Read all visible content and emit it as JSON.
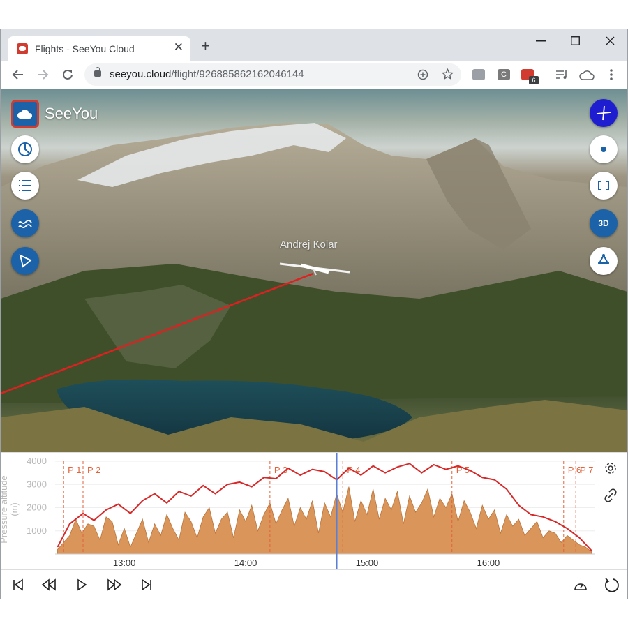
{
  "browser": {
    "tab_title": "Flights - SeeYou Cloud",
    "tab_close": "✕",
    "new_tab": "+",
    "url_host": "seeyou.cloud",
    "url_path": "/flight/926885862162046144",
    "ext_badge": "6",
    "ext_c": "C"
  },
  "app": {
    "brand": "SeeYou",
    "pilot_label": "Andrej Kolar",
    "btn_3d": "3D"
  },
  "chart_data": {
    "type": "area",
    "ylabel": "Pressure altitude (m)",
    "y_ticks": [
      "4000",
      "3000",
      "2000",
      "1000"
    ],
    "ylim": [
      0,
      4000
    ],
    "x_ticks": [
      "13:00",
      "14:00",
      "15:00",
      "16:00"
    ],
    "x_tick_hours": [
      13,
      14,
      15,
      16
    ],
    "xlim_hours": [
      12.43,
      16.88
    ],
    "cursor_hour": 14.75,
    "turnpoints": [
      {
        "label": "P 1",
        "hour": 12.5
      },
      {
        "label": "P 2",
        "hour": 12.66
      },
      {
        "label": "P 3",
        "hour": 14.2
      },
      {
        "label": "P 4",
        "hour": 14.8
      },
      {
        "label": "P 5",
        "hour": 15.7
      },
      {
        "label": "P 6",
        "hour": 16.62
      },
      {
        "label": "P 7",
        "hour": 16.72
      }
    ],
    "series": [
      {
        "color": "#d62a2a",
        "x": [
          12.45,
          12.55,
          12.66,
          12.75,
          12.85,
          12.95,
          13.05,
          13.15,
          13.25,
          13.35,
          13.45,
          13.55,
          13.65,
          13.75,
          13.85,
          13.95,
          14.05,
          14.15,
          14.25,
          14.35,
          14.45,
          14.55,
          14.65,
          14.75,
          14.85,
          14.95,
          15.05,
          15.15,
          15.25,
          15.35,
          15.45,
          15.55,
          15.65,
          15.75,
          15.85,
          15.95,
          16.05,
          16.15,
          16.25,
          16.35,
          16.45,
          16.55,
          16.65,
          16.75,
          16.85
        ],
        "values": [
          300,
          1300,
          1750,
          1450,
          1900,
          2150,
          1750,
          2300,
          2600,
          2200,
          2700,
          2500,
          2950,
          2600,
          3000,
          3100,
          2900,
          3300,
          3250,
          3700,
          3400,
          3650,
          3550,
          3200,
          3700,
          3400,
          3800,
          3500,
          3750,
          3900,
          3500,
          3850,
          3650,
          3800,
          3600,
          3300,
          3200,
          2800,
          2100,
          1700,
          1600,
          1400,
          1100,
          700,
          150
        ]
      }
    ],
    "terrain": {
      "color": "#d9955a",
      "x": [
        12.45,
        12.55,
        12.6,
        12.65,
        12.7,
        12.75,
        12.8,
        12.85,
        12.9,
        12.95,
        13.0,
        13.05,
        13.1,
        13.15,
        13.2,
        13.25,
        13.3,
        13.35,
        13.4,
        13.45,
        13.5,
        13.55,
        13.6,
        13.65,
        13.7,
        13.75,
        13.8,
        13.85,
        13.9,
        13.95,
        14.0,
        14.05,
        14.1,
        14.15,
        14.2,
        14.25,
        14.3,
        14.35,
        14.4,
        14.45,
        14.5,
        14.55,
        14.6,
        14.65,
        14.7,
        14.75,
        14.8,
        14.85,
        14.9,
        14.95,
        15.0,
        15.05,
        15.1,
        15.15,
        15.2,
        15.25,
        15.3,
        15.35,
        15.4,
        15.45,
        15.5,
        15.55,
        15.6,
        15.65,
        15.7,
        15.75,
        15.8,
        15.85,
        15.9,
        15.95,
        16.0,
        16.05,
        16.1,
        16.15,
        16.2,
        16.25,
        16.3,
        16.35,
        16.4,
        16.45,
        16.5,
        16.55,
        16.6,
        16.65,
        16.7,
        16.75,
        16.8,
        16.85
      ],
      "values": [
        200,
        800,
        1500,
        900,
        1300,
        1200,
        600,
        1600,
        1400,
        400,
        1100,
        300,
        900,
        1500,
        500,
        1300,
        800,
        1700,
        1100,
        600,
        1800,
        1400,
        700,
        1600,
        2000,
        900,
        1500,
        1800,
        700,
        1900,
        1400,
        2100,
        1000,
        1700,
        2200,
        1300,
        1900,
        2400,
        1200,
        2000,
        1500,
        2300,
        900,
        2200,
        1600,
        2600,
        1800,
        2900,
        1400,
        2300,
        1700,
        2800,
        1500,
        2400,
        1900,
        2700,
        1300,
        2500,
        1800,
        2200,
        2800,
        1600,
        2400,
        2000,
        2600,
        1400,
        2300,
        1800,
        1100,
        2100,
        1500,
        1900,
        900,
        1700,
        1200,
        1500,
        800,
        1100,
        1400,
        700,
        1000,
        900,
        500,
        800,
        600,
        400,
        300,
        100
      ]
    }
  }
}
